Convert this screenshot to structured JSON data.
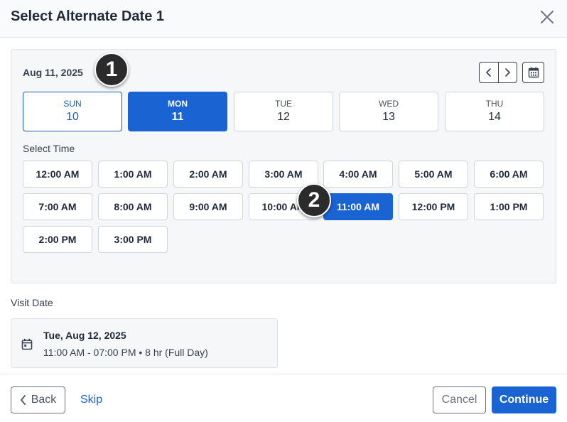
{
  "dialog": {
    "title": "Select Alternate Date 1"
  },
  "calendar": {
    "current_date": "Aug 11, 2025",
    "days": [
      {
        "name": "SUN",
        "num": "10"
      },
      {
        "name": "MON",
        "num": "11"
      },
      {
        "name": "TUE",
        "num": "12"
      },
      {
        "name": "WED",
        "num": "13"
      },
      {
        "name": "THU",
        "num": "14"
      }
    ],
    "select_time_label": "Select Time",
    "slots": [
      "12:00 AM",
      "1:00 AM",
      "2:00 AM",
      "3:00 AM",
      "4:00 AM",
      "5:00 AM",
      "6:00 AM",
      "7:00 AM",
      "8:00 AM",
      "9:00 AM",
      "10:00 AM",
      "11:00 AM",
      "12:00 PM",
      "1:00 PM",
      "2:00 PM",
      "3:00 PM"
    ],
    "selected_slot": "11:00 AM",
    "selected_day": "MON"
  },
  "annotations": {
    "badge_1": "1",
    "badge_2": "2"
  },
  "visit": {
    "label": "Visit Date",
    "date": "Tue, Aug 12, 2025",
    "time": "11:00 AM - 07:00 PM • 8 hr (Full Day)"
  },
  "footer": {
    "back": "Back",
    "skip": "Skip",
    "cancel": "Cancel",
    "continue": "Continue"
  },
  "colors": {
    "accent": "#1a63d3",
    "today_border": "#1a5ebb"
  },
  "icons": {
    "close": "close-icon",
    "prev": "chevron-left-icon",
    "next": "chevron-right-icon",
    "calendar": "calendar-icon",
    "back": "chevron-left-icon"
  }
}
